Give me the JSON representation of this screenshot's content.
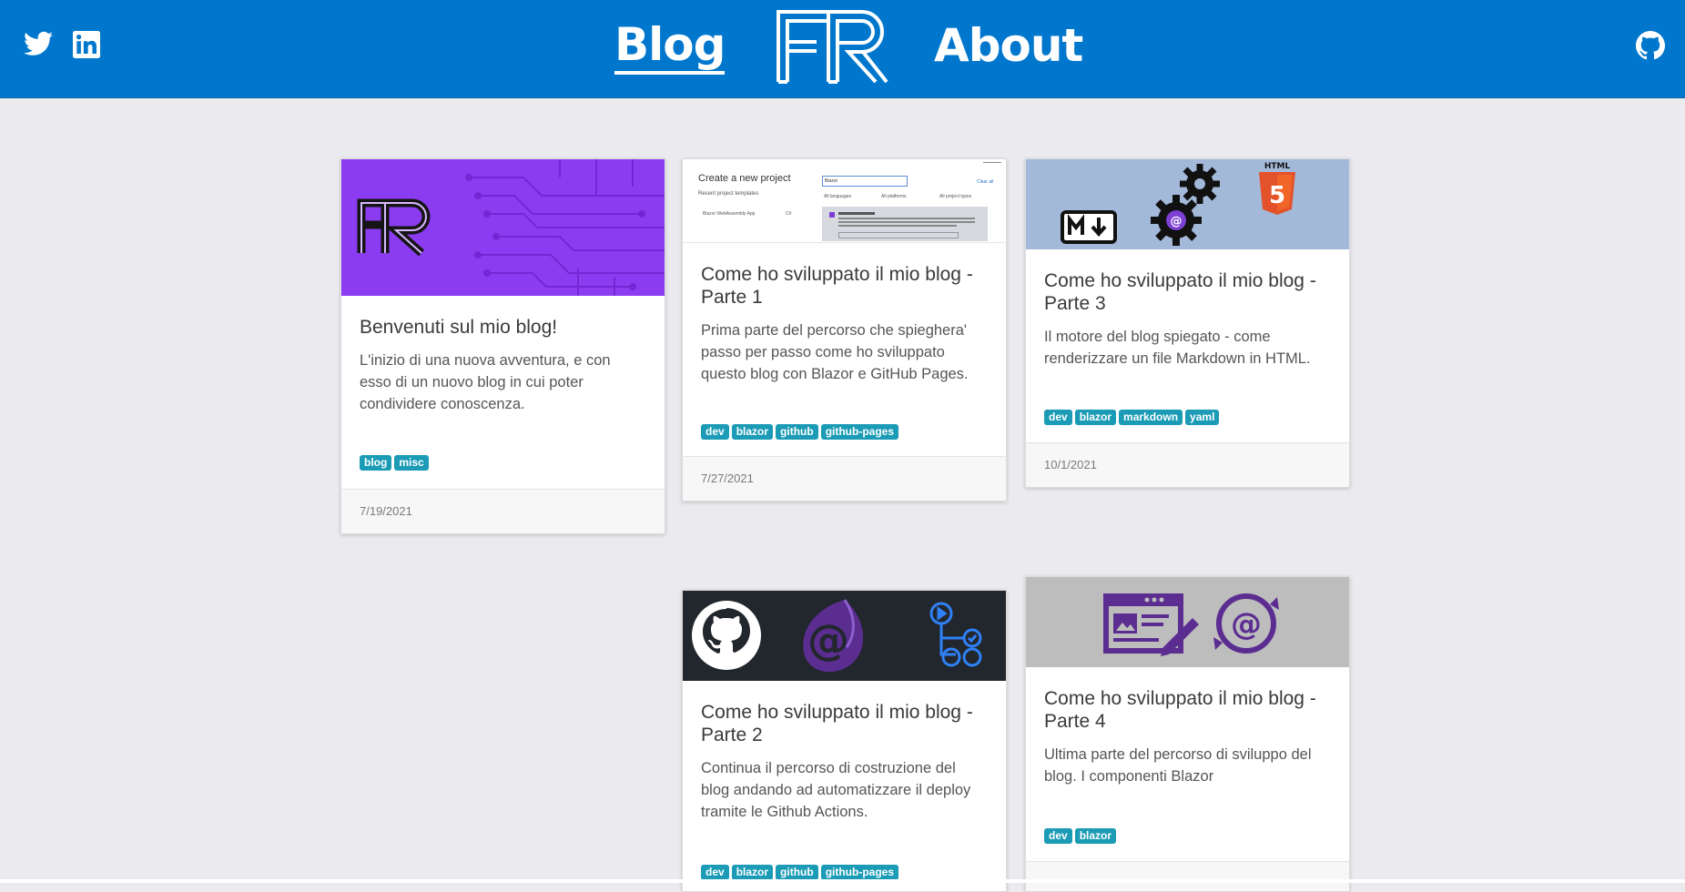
{
  "nav": {
    "blog_label": "Blog",
    "about_label": "About",
    "logo_text": "FR",
    "twitter_icon": "twitter-icon",
    "linkedin_icon": "linkedin-icon",
    "github_icon": "github-icon"
  },
  "colors": {
    "header": "#0077cc",
    "background": "#ebebef",
    "tag": "#1b9bb5"
  },
  "posts": [
    {
      "title": "Benvenuti sul mio blog!",
      "summary": "L'inizio di una nuova avventura, e con esso di un nuovo blog in cui poter condividere conoscenza.",
      "tags": [
        "blog",
        "misc"
      ],
      "date": "7/19/2021",
      "image": "fr-logo-purple-circuit"
    },
    {
      "title": "Come ho sviluppato il mio blog - Parte 1",
      "summary": "Prima parte del percorso che spieghera' passo per passo come ho sviluppato questo blog con Blazor e GitHub Pages.",
      "tags": [
        "dev",
        "blazor",
        "github",
        "github-pages"
      ],
      "date": "7/27/2021",
      "image": "create-new-project-screenshot",
      "image_text": {
        "heading": "Create a new project",
        "recent": "Recent project templates",
        "template": "Blazor WebAssembly App",
        "lang": "C#",
        "search": "Blazor",
        "clear": "Clear all",
        "filters": [
          "All languages",
          "All platforms",
          "All project types"
        ]
      }
    },
    {
      "title": "Come ho sviluppato il mio blog - Parte 3",
      "summary": "Il motore del blog spiegato - come renderizzare un file Markdown in HTML.",
      "tags": [
        "dev",
        "blazor",
        "markdown",
        "yaml"
      ],
      "date": "10/1/2021",
      "image": "markdown-gears-html5",
      "image_text": {
        "html_label": "HTML",
        "html_number": "5"
      }
    },
    {
      "title": "Come ho sviluppato il mio blog - Parte 2",
      "summary": "Continua il percorso di costruzione del blog andando ad automatizzare il deploy tramite le Github Actions.",
      "tags": [
        "dev",
        "blazor",
        "github",
        "github-pages"
      ],
      "image": "github-blazor-actions"
    },
    {
      "title": "Come ho sviluppato il mio blog - Parte 4",
      "summary": "Ultima parte del percorso di sviluppo del blog. I componenti Blazor",
      "tags": [
        "dev",
        "blazor"
      ],
      "image": "browser-blazor-icons"
    }
  ]
}
